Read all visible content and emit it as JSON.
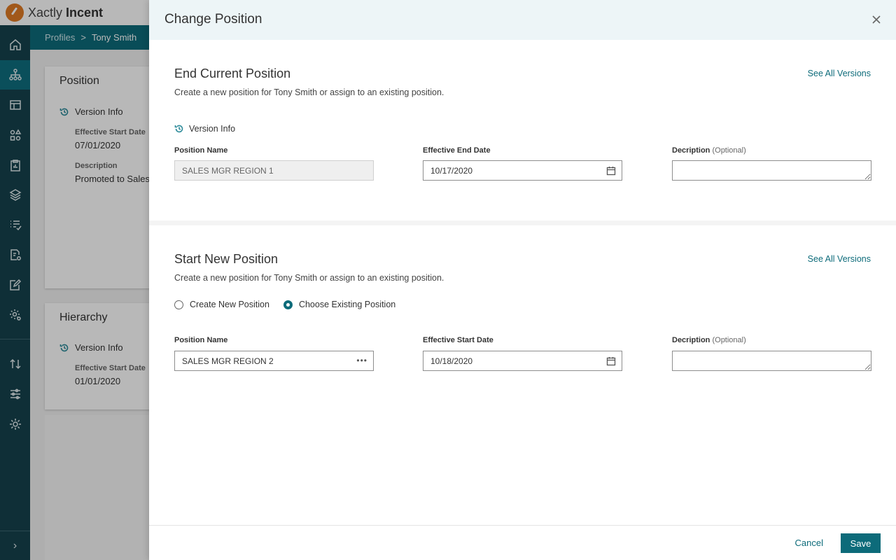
{
  "app": {
    "brand_first": "Xactly",
    "brand_second": "Incent"
  },
  "breadcrumb": {
    "parent": "Profiles",
    "separator": ">",
    "current": "Tony Smith"
  },
  "background": {
    "position_card": {
      "title": "Position",
      "version_info": "Version Info",
      "start_label": "Effective Start Date",
      "start_value": "07/01/2020",
      "desc_label": "Description",
      "desc_value": "Promoted to Sales"
    },
    "hierarchy_card": {
      "title": "Hierarchy",
      "version_info": "Version Info",
      "start_label": "Effective Start Date",
      "start_value": "01/01/2020"
    }
  },
  "drawer": {
    "title": "Change Position",
    "end_section": {
      "title": "End Current Position",
      "description": "Create a new position for Tony Smith or assign to an existing position.",
      "see_all": "See All Versions",
      "version_info": "Version Info",
      "position_name_label": "Position Name",
      "position_name_value": "SALES MGR REGION 1",
      "end_date_label": "Effective End Date",
      "end_date_value": "10/17/2020",
      "desc_label": "Decription",
      "desc_optional": "(Optional)"
    },
    "start_section": {
      "title": "Start New Position",
      "description": "Create a new position for Tony Smith or assign to an existing position.",
      "see_all": "See All Versions",
      "radio_create": "Create New Position",
      "radio_choose": "Choose Existing Position",
      "selected": "choose",
      "position_name_label": "Position Name",
      "position_name_value": "SALES MGR REGION 2",
      "start_date_label": "Effective Start Date",
      "start_date_value": "10/18/2020",
      "desc_label": "Decription",
      "desc_optional": "(Optional)"
    },
    "footer": {
      "cancel": "Cancel",
      "save": "Save"
    }
  },
  "colors": {
    "sidebar": "#16424d",
    "accent": "#0d6b7a",
    "brand_orange": "#e07b24"
  }
}
